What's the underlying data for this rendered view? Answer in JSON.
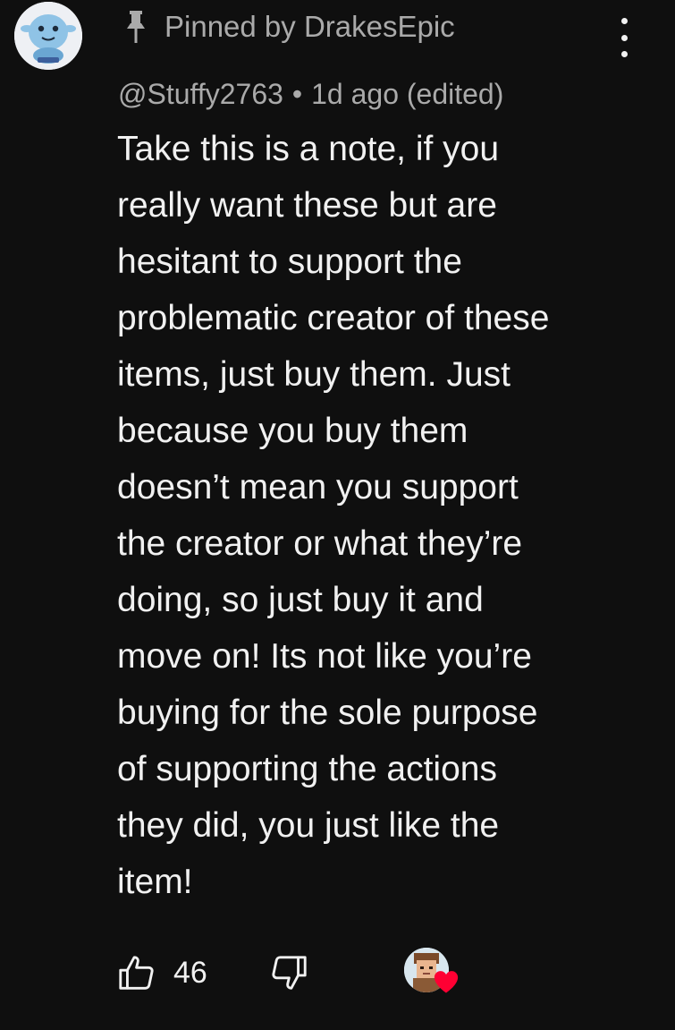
{
  "comment": {
    "pinned_label": "Pinned by DrakesEpic",
    "author": "@Stuffy2763",
    "separator": "•",
    "time": "1d ago (edited)",
    "body_lines": [
      "Take this is a note, if you",
      "really want these but are",
      "hesitant to support the",
      "problematic creator of these",
      "items, just buy them. Just",
      "because you buy them",
      "doesn’t mean you support",
      "the creator or what they’re",
      "doing, so just buy it and",
      "move on! Its not like you’re",
      "buying for the sole purpose",
      "of supporting the actions",
      "they did, you just like the",
      "item!"
    ],
    "like_count": "46"
  },
  "icons": {
    "pin": "pin-icon",
    "more": "more-vertical-icon",
    "like": "thumbs-up-icon",
    "dislike": "thumbs-down-icon",
    "heart": "heart-icon"
  },
  "colors": {
    "background": "#0f0f0f",
    "text_primary": "#f1f1f1",
    "text_secondary": "#aaaaaa",
    "heart": "#ff0033"
  }
}
